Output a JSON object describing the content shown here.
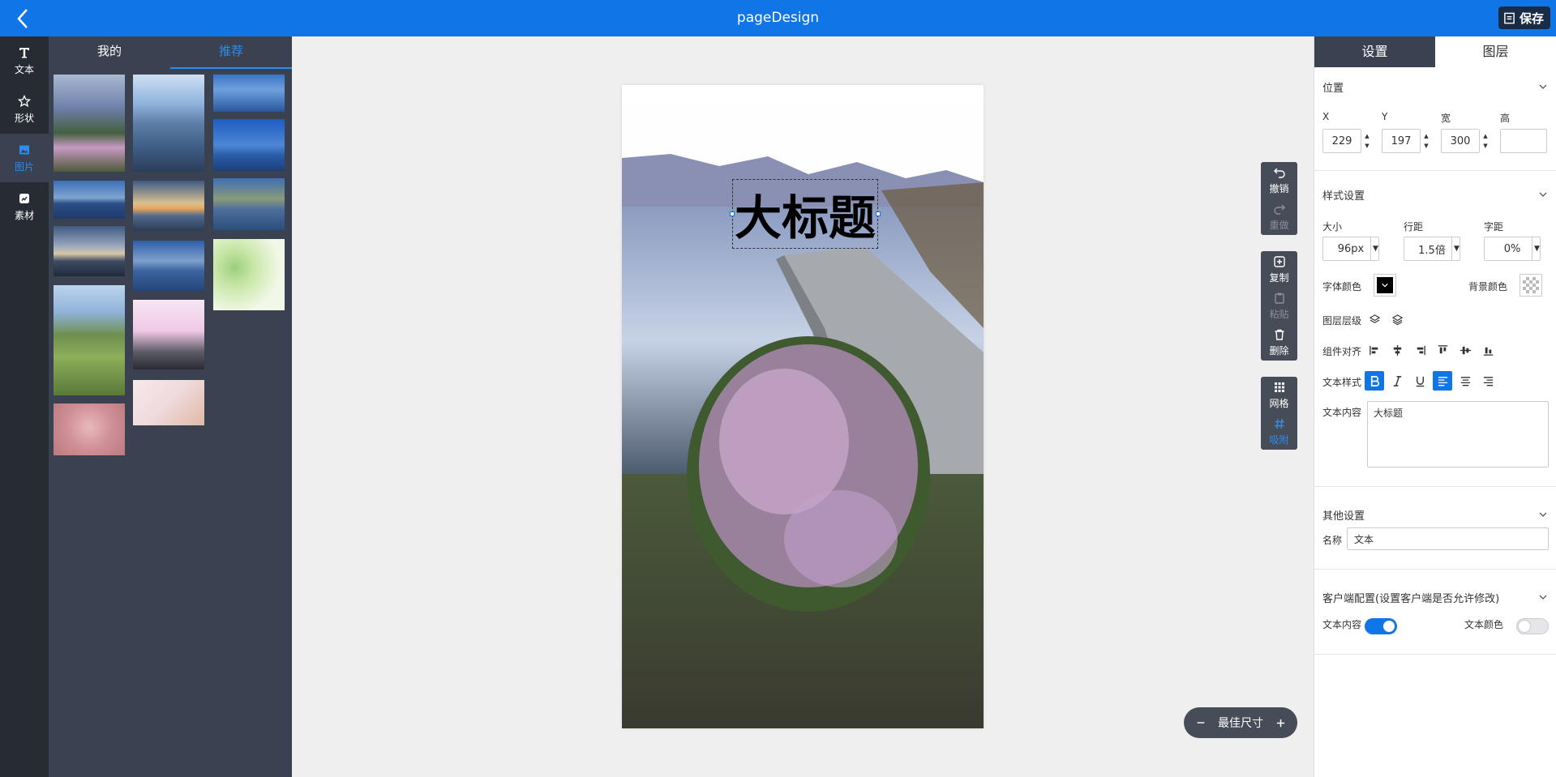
{
  "header": {
    "title": "pageDesign",
    "save_label": "保存"
  },
  "rail": {
    "items": [
      {
        "label": "文本",
        "icon": "text-icon"
      },
      {
        "label": "形状",
        "icon": "star-icon"
      },
      {
        "label": "图片",
        "icon": "image-icon"
      },
      {
        "label": "素材",
        "icon": "material-icon"
      }
    ]
  },
  "image_panel": {
    "tabs": [
      "我的",
      "推荐"
    ],
    "active_tab": "推荐"
  },
  "canvas": {
    "title_text": "大标题"
  },
  "tools": {
    "undo": "撤销",
    "redo": "重做",
    "copy": "复制",
    "paste": "粘贴",
    "delete": "删除",
    "grid": "网格",
    "snap": "吸附"
  },
  "zoom": {
    "label": "最佳尺寸"
  },
  "right_panel": {
    "tabs": [
      "设置",
      "图层"
    ],
    "active_tab": "设置",
    "position": {
      "heading": "位置",
      "x_label": "X",
      "y_label": "Y",
      "w_label": "宽",
      "h_label": "高",
      "x": "229",
      "y": "197",
      "w": "300",
      "h": ""
    },
    "style": {
      "heading": "样式设置",
      "size_label": "大小",
      "size": "96px",
      "line_label": "行距",
      "line": "1.5倍",
      "spacing_label": "字距",
      "spacing": "0%",
      "font_color_label": "字体颜色",
      "font_color": "#000000",
      "bg_color_label": "背景颜色",
      "layer_label": "图层层级",
      "align_label": "组件对齐",
      "text_style_label": "文本样式",
      "content_label": "文本内容",
      "content": "大标题"
    },
    "other": {
      "heading": "其他设置",
      "name_label": "名称",
      "name": "文本"
    },
    "client": {
      "heading": "客户端配置(设置客户端是否允许修改)",
      "content_label": "文本内容",
      "content_on": true,
      "color_label": "文本颜色",
      "color_on": false
    }
  },
  "colors": {
    "brand": "#1076e8",
    "dark": "#3a4150",
    "rail": "#262b34"
  }
}
